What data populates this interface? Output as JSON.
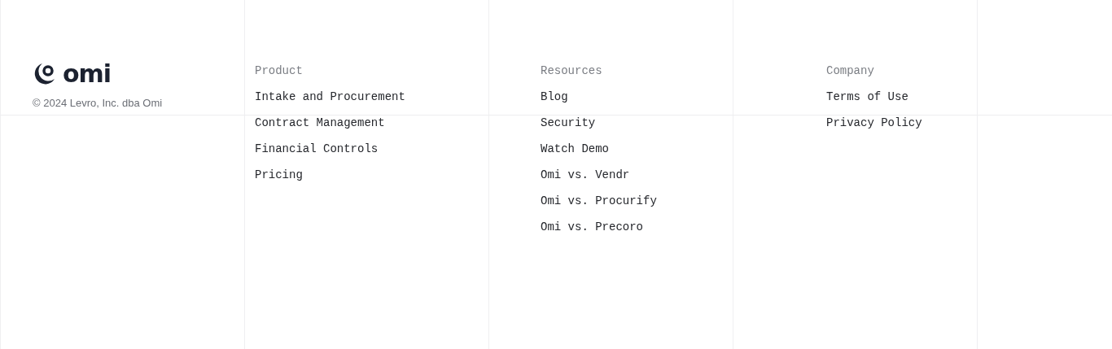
{
  "brand": {
    "logo_text": "omi",
    "copyright": "© 2024 Levro, Inc. dba Omi"
  },
  "columns": [
    {
      "heading": "Product",
      "links": [
        "Intake and Procurement",
        "Contract Management",
        "Financial Controls",
        "Pricing"
      ]
    },
    {
      "heading": "Resources",
      "links": [
        "Blog",
        "Security",
        "Watch Demo",
        "Omi vs. Vendr",
        "Omi vs. Procurify",
        "Omi vs. Precoro"
      ]
    },
    {
      "heading": "Company",
      "links": [
        "Terms of Use",
        "Privacy Policy"
      ]
    }
  ]
}
